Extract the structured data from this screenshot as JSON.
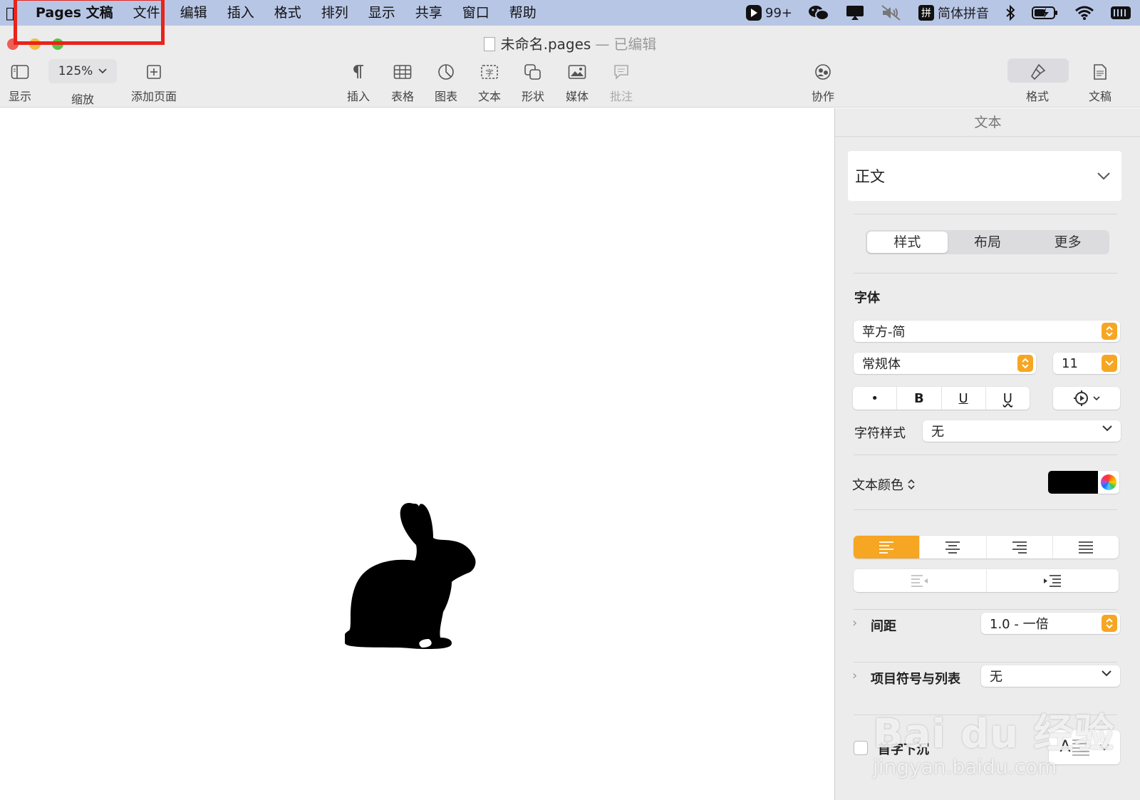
{
  "menubar": {
    "app_name": "Pages 文稿",
    "items": [
      "文件",
      "编辑",
      "插入",
      "格式",
      "排列",
      "显示",
      "共享",
      "窗口",
      "帮助"
    ],
    "status": {
      "badge_count": "99+",
      "input_method": "简体拼音"
    }
  },
  "window": {
    "document_title": "未命名.pages",
    "separator": "—",
    "edited_label": "已编辑"
  },
  "toolbar": {
    "view_label": "显示",
    "zoom_value": "125%",
    "zoom_label": "缩放",
    "add_page_label": "添加页面",
    "insert_label": "插入",
    "table_label": "表格",
    "chart_label": "图表",
    "text_label": "文本",
    "shape_label": "形状",
    "media_label": "媒体",
    "comment_label": "批注",
    "collaborate_label": "协作",
    "format_label": "格式",
    "document_label": "文稿"
  },
  "inspector": {
    "header": "文本",
    "paragraph_style": "正文",
    "tabs": [
      "样式",
      "布局",
      "更多"
    ],
    "active_tab": "样式",
    "font_section": "字体",
    "font_family": "苹方-简",
    "font_typeface": "常规体",
    "font_size": "11",
    "bullet_symbol": "•",
    "bold_label": "B",
    "underline_label": "U",
    "underline2_label": "U",
    "char_style_label": "字符样式",
    "char_style_value": "无",
    "text_color_label": "文本颜色",
    "text_color": "#000000",
    "alignment": "left",
    "spacing_label": "间距",
    "spacing_value": "1.0 - 一倍",
    "bullets_label": "项目符号与列表",
    "bullets_value": "无",
    "dropcap_label": "首字下沉",
    "dropcap_glyph": "A"
  },
  "watermark": {
    "line1": "Bai du 经验",
    "line2": "jingyan.baidu.com"
  },
  "colors": {
    "accent": "#f6a623",
    "menubar_bg": "#b8c6e6",
    "highlight_box": "#e8241b"
  }
}
